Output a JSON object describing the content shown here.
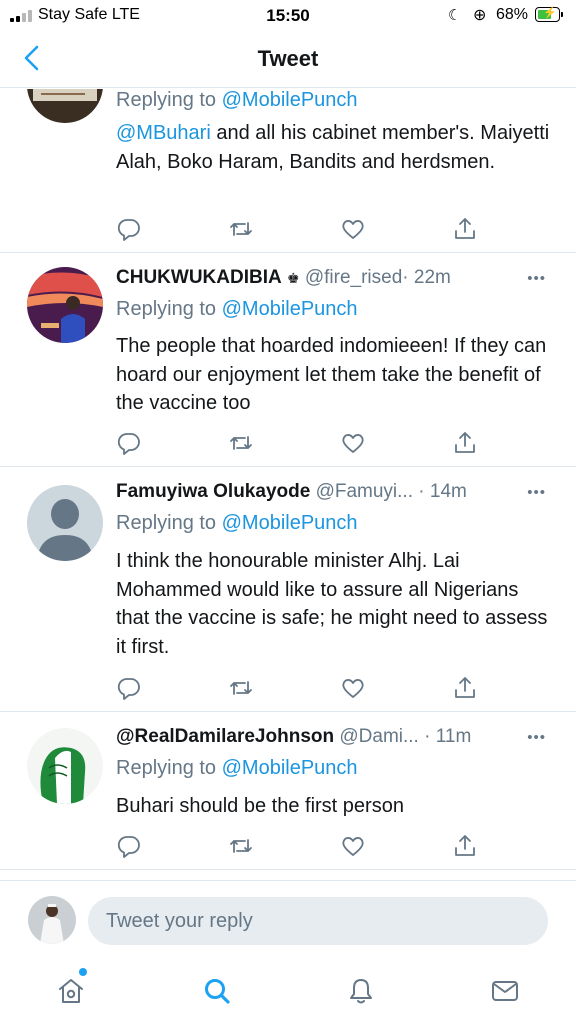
{
  "status_bar": {
    "carrier": "Stay Safe  LTE",
    "time": "15:50",
    "battery_pct": "68%",
    "battery_level": 0.68
  },
  "nav": {
    "title": "Tweet"
  },
  "tweets": [
    {
      "reply_prefix": "Replying to",
      "reply_to": "@MobilePunch",
      "text_mention": "@MBuhari",
      "text": " and all his cabinet member's. Maiyetti Alah, Boko Haram, Bandits and herdsmen."
    },
    {
      "name": "CHUKWUKADIBIA",
      "name_badge": "♚",
      "handle": "@fire_rised",
      "time": "· 22m",
      "reply_prefix": "Replying to",
      "reply_to": "@MobilePunch",
      "text": "The people that hoarded indomieeen! If they can hoard our enjoyment let them take the benefit of the vaccine too"
    },
    {
      "name": "Famuyiwa Olukayode",
      "handle": "@Famuyi...",
      "time": "· 14m",
      "reply_prefix": "Replying to",
      "reply_to": "@MobilePunch",
      "text": "I think the honourable minister  Alhj. Lai Mohammed would like to assure all Nigerians that the vaccine is safe; he might need to assess it first."
    },
    {
      "name": "@RealDamilareJohnson",
      "handle": "@Dami...",
      "time": "· 11m",
      "reply_prefix": "Replying to",
      "reply_to": "@MobilePunch",
      "text": "Buhari should be the first person"
    }
  ],
  "more_glyph": "•••",
  "reply_bar": {
    "placeholder": "Tweet your reply"
  },
  "colors": {
    "accent": "#1da1f2",
    "mention": "#1b95e0",
    "muted": "#657786",
    "divider": "#e1e8ed"
  },
  "icons": [
    "back-chevron-icon",
    "reply-icon",
    "retweet-icon",
    "like-icon",
    "share-icon",
    "home-icon",
    "search-icon",
    "notifications-icon",
    "messages-icon"
  ]
}
